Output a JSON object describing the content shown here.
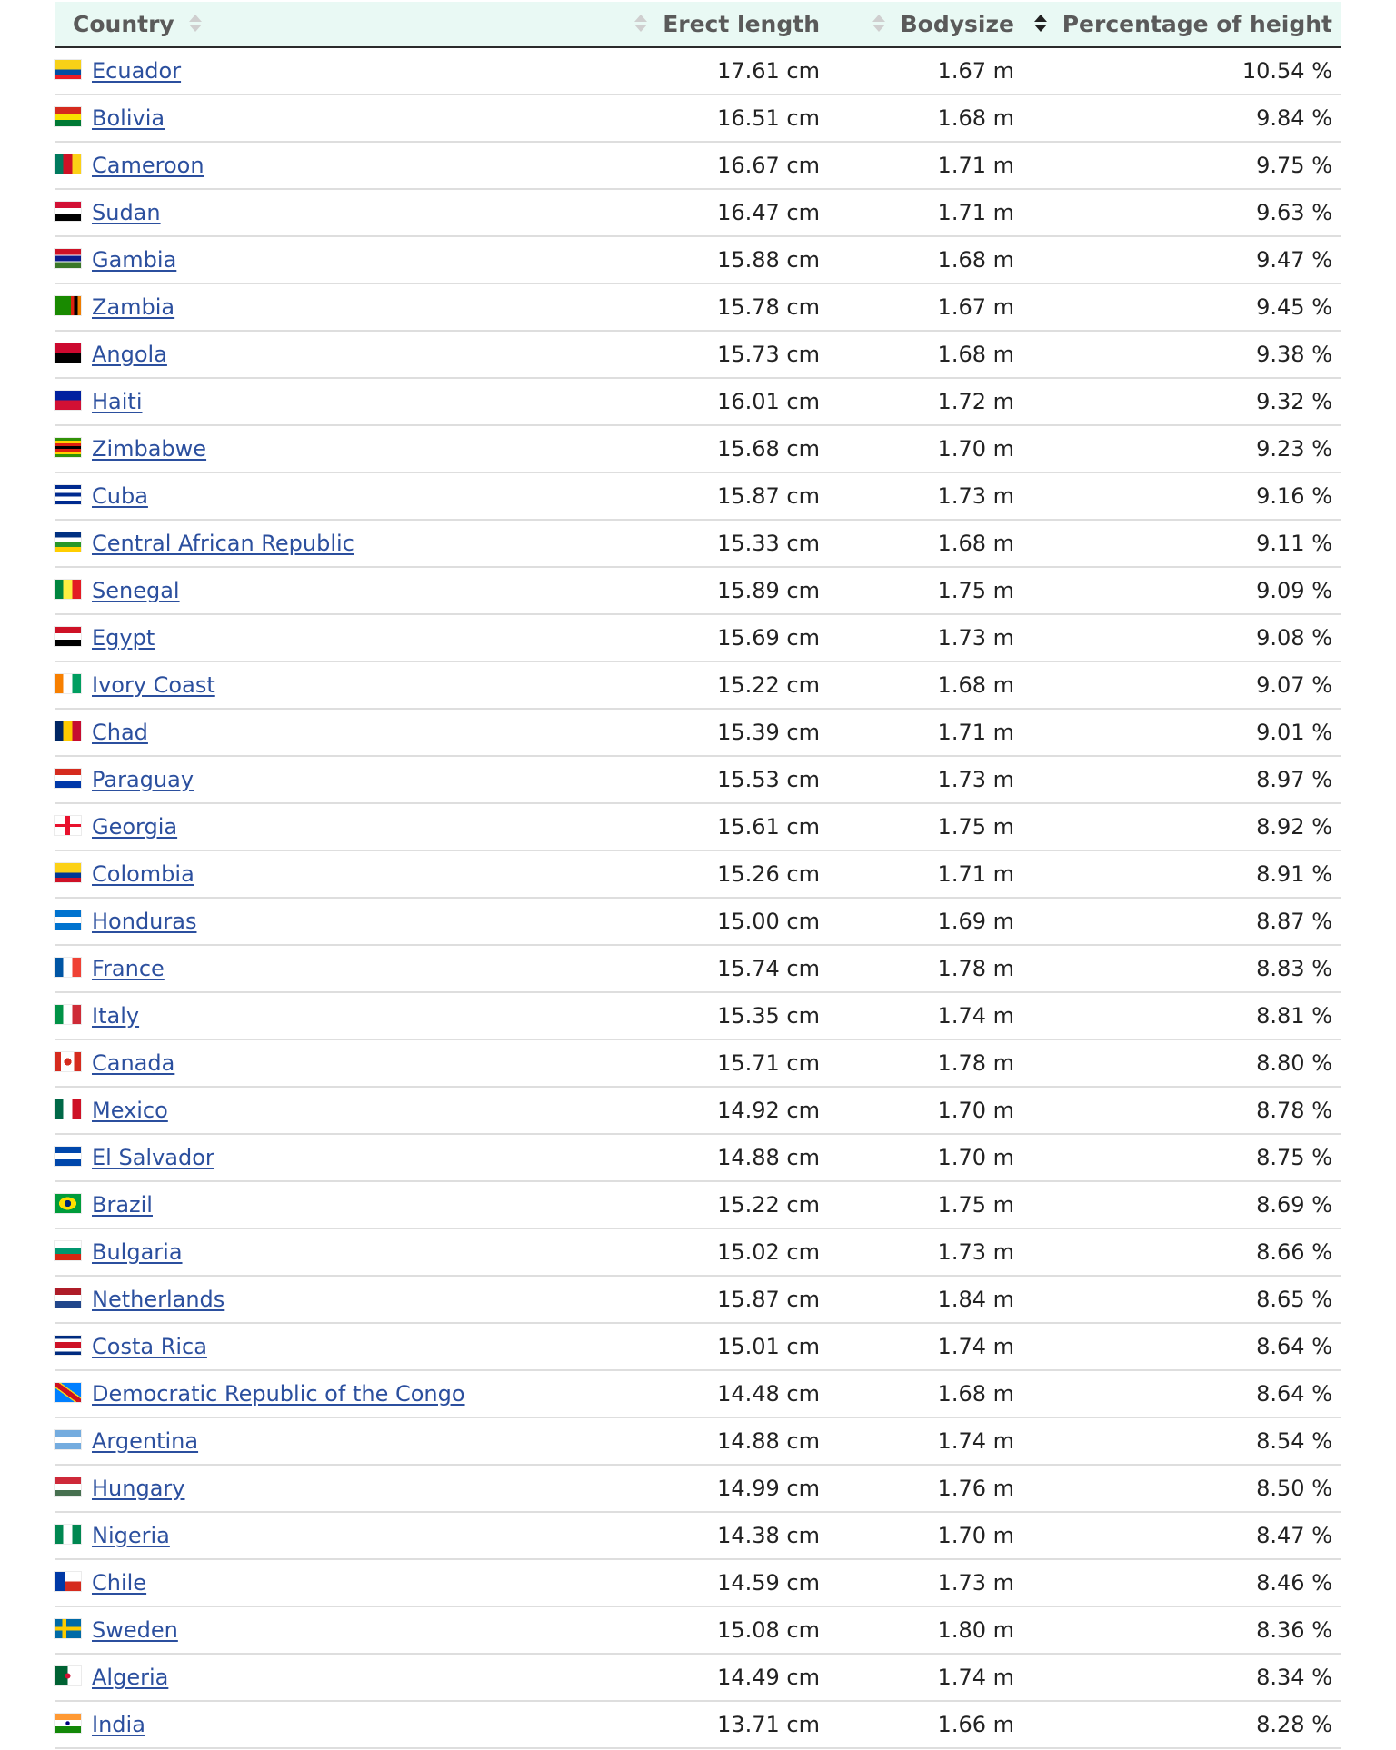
{
  "header": {
    "country": "Country",
    "erect_length": "Erect length",
    "bodysize": "Bodysize",
    "percentage_of_height": "Percentage of height"
  },
  "rows": [
    {
      "country": "Ecuador",
      "erect": "17.61 cm",
      "body": "1.67 m",
      "pct": "10.54 %",
      "flag": "linear-gradient(to bottom, #f7d117 0 50%, #034ea2 50% 75%, #ed1c24 75%)"
    },
    {
      "country": "Bolivia",
      "erect": "16.51 cm",
      "body": "1.68 m",
      "pct": "9.84 %",
      "flag": "linear-gradient(to bottom, #d52b1e 0 33.3%, #f9e300 33.3% 66.6%, #007934 66.6%)"
    },
    {
      "country": "Cameroon",
      "erect": "16.67 cm",
      "body": "1.71 m",
      "pct": "9.75 %",
      "flag": "linear-gradient(to right, #007a5e 0 33.3%, #ce1126 33.3% 66.6%, #fcd116 66.6%)"
    },
    {
      "country": "Sudan",
      "erect": "16.47 cm",
      "body": "1.71 m",
      "pct": "9.63 %",
      "flag": "linear-gradient(to bottom, #d21034 0 33.3%, #ffffff 33.3% 66.6%, #000000 66.6%)"
    },
    {
      "country": "Gambia",
      "erect": "15.88 cm",
      "body": "1.68 m",
      "pct": "9.47 %",
      "flag": "linear-gradient(to bottom, #ce1126 0 30%, #ffffff 30% 36%, #0c1c8c 36% 64%, #ffffff 64% 70%, #3a7728 70%)"
    },
    {
      "country": "Zambia",
      "erect": "15.78 cm",
      "body": "1.67 m",
      "pct": "9.45 %",
      "flag": "linear-gradient(to right, #198a00 0 62%, #de2010 62% 75%, #000000 75% 88%, #ef7d00 88%)"
    },
    {
      "country": "Angola",
      "erect": "15.73 cm",
      "body": "1.68 m",
      "pct": "9.38 %",
      "flag": "linear-gradient(to bottom, #cc092f 0 50%, #000000 50%)"
    },
    {
      "country": "Haiti",
      "erect": "16.01 cm",
      "body": "1.72 m",
      "pct": "9.32 %",
      "flag": "linear-gradient(to bottom, #00209f 0 50%, #d21034 50%)"
    },
    {
      "country": "Zimbabwe",
      "erect": "15.68 cm",
      "body": "1.70 m",
      "pct": "9.23 %",
      "flag": "linear-gradient(to bottom, #319208 0 14%, #ffd200 14% 28%, #de2010 28% 42%, #000000 42% 58%, #de2010 58% 72%, #ffd200 72% 86%, #319208 86%)"
    },
    {
      "country": "Cuba",
      "erect": "15.87 cm",
      "body": "1.73 m",
      "pct": "9.16 %",
      "flag": "linear-gradient(to bottom, #002a8f 0 20%, #ffffff 20% 40%, #002a8f 40% 60%, #ffffff 60% 80%, #002a8f 80%)"
    },
    {
      "country": "Central African Republic",
      "erect": "15.33 cm",
      "body": "1.68 m",
      "pct": "9.11 %",
      "flag": "linear-gradient(to bottom, #003082 0 25%, #ffffff 25% 50%, #289728 50% 75%, #ffce00 75%)"
    },
    {
      "country": "Senegal",
      "erect": "15.89 cm",
      "body": "1.75 m",
      "pct": "9.09 %",
      "flag": "linear-gradient(to right, #00853f 0 33.3%, #fdef42 33.3% 66.6%, #e31b23 66.6%)"
    },
    {
      "country": "Egypt",
      "erect": "15.69 cm",
      "body": "1.73 m",
      "pct": "9.08 %",
      "flag": "linear-gradient(to bottom, #ce1126 0 33.3%, #ffffff 33.3% 66.6%, #000000 66.6%)"
    },
    {
      "country": "Ivory Coast",
      "erect": "15.22 cm",
      "body": "1.68 m",
      "pct": "9.07 %",
      "flag": "linear-gradient(to right, #f77f00 0 33.3%, #ffffff 33.3% 66.6%, #009e60 66.6%)"
    },
    {
      "country": "Chad",
      "erect": "15.39 cm",
      "body": "1.71 m",
      "pct": "9.01 %",
      "flag": "linear-gradient(to right, #002664 0 33.3%, #fecb00 33.3% 66.6%, #c60c30 66.6%)"
    },
    {
      "country": "Paraguay",
      "erect": "15.53 cm",
      "body": "1.73 m",
      "pct": "8.97 %",
      "flag": "linear-gradient(to bottom, #d52b1e 0 33.3%, #ffffff 33.3% 66.6%, #0038a8 66.6%)"
    },
    {
      "country": "Georgia",
      "erect": "15.61 cm",
      "body": "1.75 m",
      "pct": "8.92 %",
      "flag": "linear-gradient(to bottom, transparent 0 42%, #e8112d 42% 58%, transparent 58%), linear-gradient(to right, #ffffff 0 42%, #e8112d 42% 58%, #ffffff 58%)"
    },
    {
      "country": "Colombia",
      "erect": "15.26 cm",
      "body": "1.71 m",
      "pct": "8.91 %",
      "flag": "linear-gradient(to bottom, #fcd116 0 50%, #003893 50% 75%, #ce1126 75%)"
    },
    {
      "country": "Honduras",
      "erect": "15.00 cm",
      "body": "1.69 m",
      "pct": "8.87 %",
      "flag": "linear-gradient(to bottom, #0073cf 0 33.3%, #ffffff 33.3% 66.6%, #0073cf 66.6%)"
    },
    {
      "country": "France",
      "erect": "15.74 cm",
      "body": "1.78 m",
      "pct": "8.83 %",
      "flag": "linear-gradient(to right, #0055a4 0 33.3%, #ffffff 33.3% 66.6%, #ef4135 66.6%)"
    },
    {
      "country": "Italy",
      "erect": "15.35 cm",
      "body": "1.74 m",
      "pct": "8.81 %",
      "flag": "linear-gradient(to right, #009246 0 33.3%, #ffffff 33.3% 66.6%, #ce2b37 66.6%)"
    },
    {
      "country": "Canada",
      "erect": "15.71 cm",
      "body": "1.78 m",
      "pct": "8.80 %",
      "flag": "radial-gradient(circle at 50% 50%, #d52b1e 0 22%, transparent 23%), linear-gradient(to right, #d52b1e 0 25%, #ffffff 25% 75%, #d52b1e 75%)"
    },
    {
      "country": "Mexico",
      "erect": "14.92 cm",
      "body": "1.70 m",
      "pct": "8.78 %",
      "flag": "linear-gradient(to right, #006847 0 33.3%, #ffffff 33.3% 66.6%, #ce1126 66.6%)"
    },
    {
      "country": "El Salvador",
      "erect": "14.88 cm",
      "body": "1.70 m",
      "pct": "8.75 %",
      "flag": "linear-gradient(to bottom, #0047ab 0 33.3%, #ffffff 33.3% 66.6%, #0047ab 66.6%)"
    },
    {
      "country": "Brazil",
      "erect": "15.22 cm",
      "body": "1.75 m",
      "pct": "8.69 %",
      "flag": "radial-gradient(circle at 50% 50%, #002776 0 20%, transparent 21%), radial-gradient(ellipse at 50% 50%, #ffdf00 0 46%, transparent 47%), linear-gradient(#009c3b, #009c3b)"
    },
    {
      "country": "Bulgaria",
      "erect": "15.02 cm",
      "body": "1.73 m",
      "pct": "8.66 %",
      "flag": "linear-gradient(to bottom, #ffffff 0 33.3%, #00966e 33.3% 66.6%, #d62612 66.6%)"
    },
    {
      "country": "Netherlands",
      "erect": "15.87 cm",
      "body": "1.84 m",
      "pct": "8.65 %",
      "flag": "linear-gradient(to bottom, #ae1c28 0 33.3%, #ffffff 33.3% 66.6%, #21468b 66.6%)"
    },
    {
      "country": "Costa Rica",
      "erect": "15.01 cm",
      "body": "1.74 m",
      "pct": "8.64 %",
      "flag": "linear-gradient(to bottom, #002b7f 0 16.6%, #ffffff 16.6% 33.3%, #ce1126 33.3% 66.6%, #ffffff 66.6% 83.3%, #002b7f 83.3%)"
    },
    {
      "country": "Democratic Republic of the Congo",
      "erect": "14.48 cm",
      "body": "1.68 m",
      "pct": "8.64 %",
      "flag": "linear-gradient(to top right, #007fff 0 38%, #f7d618 38% 42%, #ce1021 42% 58%, #f7d618 58% 62%, #007fff 62%)"
    },
    {
      "country": "Argentina",
      "erect": "14.88 cm",
      "body": "1.74 m",
      "pct": "8.54 %",
      "flag": "linear-gradient(to bottom, #74acdf 0 33.3%, #ffffff 33.3% 66.6%, #74acdf 66.6%)"
    },
    {
      "country": "Hungary",
      "erect": "14.99 cm",
      "body": "1.76 m",
      "pct": "8.50 %",
      "flag": "linear-gradient(to bottom, #ce2939 0 33.3%, #ffffff 33.3% 66.6%, #477050 66.6%)"
    },
    {
      "country": "Nigeria",
      "erect": "14.38 cm",
      "body": "1.70 m",
      "pct": "8.47 %",
      "flag": "linear-gradient(to right, #008751 0 33.3%, #ffffff 33.3% 66.6%, #008751 66.6%)"
    },
    {
      "country": "Chile",
      "erect": "14.59 cm",
      "body": "1.73 m",
      "pct": "8.46 %",
      "flag": "linear-gradient(to right, #0039a6 0 38%, transparent 38%), linear-gradient(to bottom, #ffffff 0 50%, #d52b1e 50%)"
    },
    {
      "country": "Sweden",
      "erect": "15.08 cm",
      "body": "1.80 m",
      "pct": "8.36 %",
      "flag": "linear-gradient(to bottom, transparent 0 40%, #fecc00 40% 60%, transparent 60%), linear-gradient(to right, #006aa7 0 30%, #fecc00 30% 44%, #006aa7 44%)"
    },
    {
      "country": "Algeria",
      "erect": "14.49 cm",
      "body": "1.74 m",
      "pct": "8.34 %",
      "flag": "radial-gradient(circle at 50% 50%, #d21034 0 16%, transparent 17%), linear-gradient(to right, #006233 0 50%, #ffffff 50%)"
    },
    {
      "country": "India",
      "erect": "13.71 cm",
      "body": "1.66 m",
      "pct": "8.28 %",
      "flag": "radial-gradient(circle at 50% 50%, #000080 0 12%, transparent 13%), linear-gradient(to bottom, #ff9933 0 33.3%, #ffffff 33.3% 66.6%, #138808 66.6%)"
    }
  ]
}
